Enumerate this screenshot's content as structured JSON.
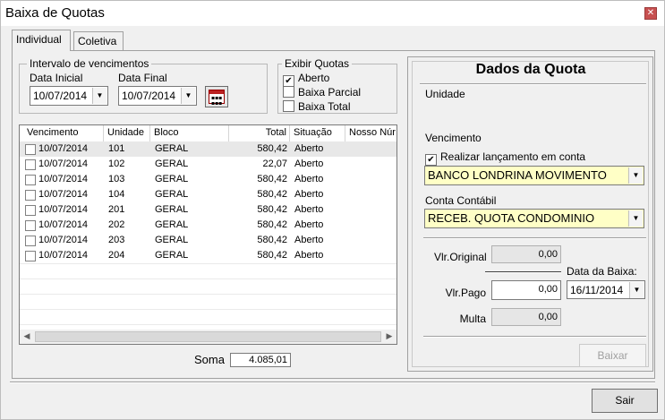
{
  "window": {
    "title": "Baixa de Quotas"
  },
  "tabs": [
    {
      "label": "Individual"
    },
    {
      "label": "Coletiva"
    }
  ],
  "intervalo": {
    "legend": "Intervalo de vencimentos",
    "data_inicial_label": "Data Inicial",
    "data_inicial": "10/07/2014",
    "data_final_label": "Data Final",
    "data_final": "10/07/2014"
  },
  "exibir": {
    "legend": "Exibir Quotas",
    "options": [
      {
        "label": "Aberto",
        "checked": true
      },
      {
        "label": "Baixa Parcial",
        "checked": false
      },
      {
        "label": "Baixa Total",
        "checked": false
      }
    ]
  },
  "list": {
    "columns": [
      "Vencimento",
      "Unidade",
      "Bloco",
      "Total",
      "Situação",
      "Nosso Núr"
    ],
    "rows": [
      {
        "vencimento": "10/07/2014",
        "unidade": "101",
        "bloco": "GERAL",
        "total": "580,42",
        "situacao": "Aberto"
      },
      {
        "vencimento": "10/07/2014",
        "unidade": "102",
        "bloco": "GERAL",
        "total": "22,07",
        "situacao": "Aberto"
      },
      {
        "vencimento": "10/07/2014",
        "unidade": "103",
        "bloco": "GERAL",
        "total": "580,42",
        "situacao": "Aberto"
      },
      {
        "vencimento": "10/07/2014",
        "unidade": "104",
        "bloco": "GERAL",
        "total": "580,42",
        "situacao": "Aberto"
      },
      {
        "vencimento": "10/07/2014",
        "unidade": "201",
        "bloco": "GERAL",
        "total": "580,42",
        "situacao": "Aberto"
      },
      {
        "vencimento": "10/07/2014",
        "unidade": "202",
        "bloco": "GERAL",
        "total": "580,42",
        "situacao": "Aberto"
      },
      {
        "vencimento": "10/07/2014",
        "unidade": "203",
        "bloco": "GERAL",
        "total": "580,42",
        "situacao": "Aberto"
      },
      {
        "vencimento": "10/07/2014",
        "unidade": "204",
        "bloco": "GERAL",
        "total": "580,42",
        "situacao": "Aberto"
      }
    ]
  },
  "soma": {
    "label": "Soma",
    "value": "4.085,01"
  },
  "quota": {
    "title": "Dados da Quota",
    "unidade_label": "Unidade",
    "vencimento_label": "Vencimento",
    "realizar_label": "Realizar lançamento em conta",
    "banco": "BANCO LONDRINA MOVIMENTO",
    "conta_label": "Conta Contábil",
    "conta": "RECEB. QUOTA CONDOMINIO",
    "vlr_original_label": "Vlr.Original",
    "vlr_original": "0,00",
    "data_baixa_label": "Data da Baixa:",
    "data_baixa": "16/11/2014",
    "vlr_pago_label": "Vlr.Pago",
    "vlr_pago": "0,00",
    "multa_label": "Multa",
    "multa": "0,00",
    "baixar_label": "Baixar"
  },
  "sair_label": "Sair"
}
